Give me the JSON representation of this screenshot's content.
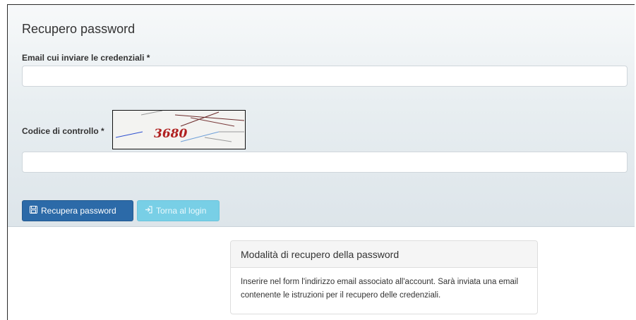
{
  "form": {
    "title": "Recupero password",
    "email_label": "Email cui inviare le credenziali *",
    "email_value": "",
    "captcha_label": "Codice di controllo *",
    "captcha_text": "3680",
    "captcha_value": ""
  },
  "buttons": {
    "recover_icon": "floppy-disk-icon",
    "recover_label": "Recupera password",
    "login_icon": "sign-in-icon",
    "login_label": "Torna al login"
  },
  "info": {
    "heading": "Modalità di recupero della password",
    "body": "Inserire nel form l'indirizzo email associato all'account. Sarà inviata una email contenente le istruzioni per il recupero delle credenziali."
  },
  "colors": {
    "primary": "#2c6aa8",
    "info": "#78cfe6"
  }
}
